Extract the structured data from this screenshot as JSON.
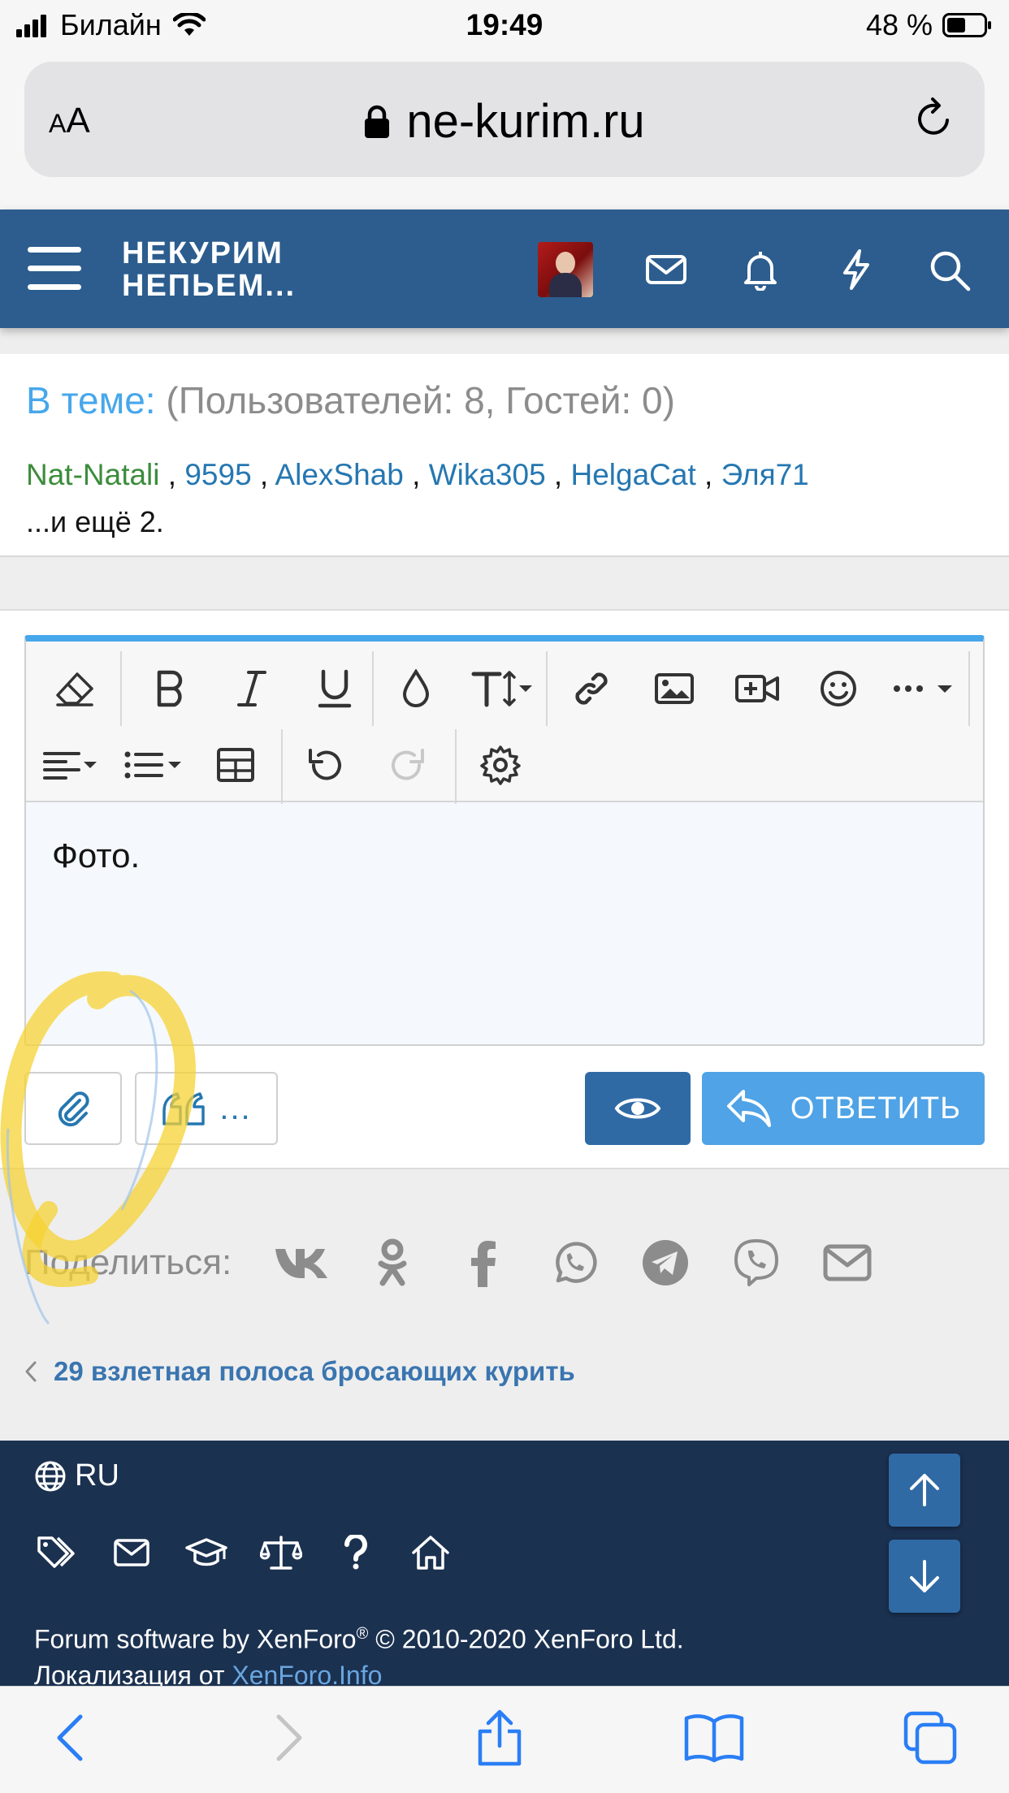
{
  "status_bar": {
    "carrier": "Билайн",
    "time": "19:49",
    "battery": "48 %"
  },
  "browser": {
    "aa_small": "A",
    "aa_large": "A",
    "url": "ne-kurim.ru"
  },
  "header": {
    "logo_line1": "НЕКУРИМ",
    "logo_line2": "НЕПЬЕМ..."
  },
  "who": {
    "title_accent": "В теме:",
    "title_rest": "(Пользователей: 8, Гостей: 0)",
    "users": [
      "Nat-Natali",
      "9595",
      "AlexShab",
      "Wika305",
      "HelgaCat",
      "Эля71"
    ],
    "separator": " , ",
    "more": "...и ещё 2."
  },
  "editor": {
    "content": "Фото.",
    "more_dots": "..."
  },
  "reply": {
    "label": "ОТВЕТИТЬ"
  },
  "share": {
    "label": "Поделиться:"
  },
  "prev_thread": {
    "label": "29 взлетная полоса бросающих курить"
  },
  "footer": {
    "language": "RU",
    "copyright_line1": "Forum software by XenForo",
    "copyright_reg": "®",
    "copyright_line1_rest": " © 2010-2020 XenForo Ltd.",
    "copyright_line2_prefix": "Локализация от ",
    "copyright_line2_link": "XenForo.Info"
  },
  "colors": {
    "header_bg": "#2c5d8e",
    "accent": "#47a7eb",
    "footer_bg": "#1b3150",
    "link": "#2577b1",
    "button_dark": "#2f6aa5",
    "button_light": "#4fa3e6"
  }
}
